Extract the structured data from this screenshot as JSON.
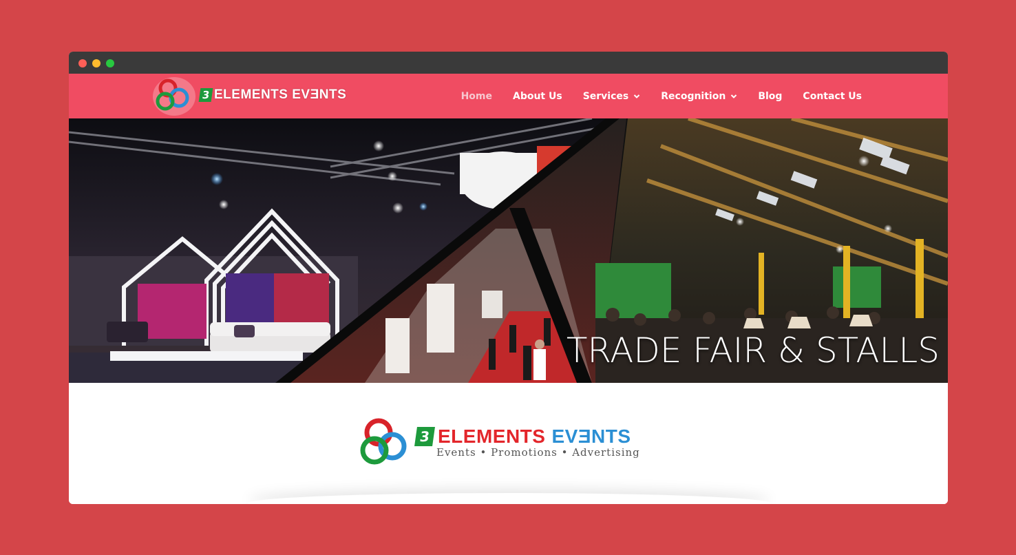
{
  "header": {
    "logo_number": "3",
    "logo_text": "ELEMENTS EVƎNTS"
  },
  "nav": {
    "items": [
      {
        "label": "Home",
        "active": true,
        "dropdown": false
      },
      {
        "label": "About Us",
        "active": false,
        "dropdown": false
      },
      {
        "label": "Services",
        "active": false,
        "dropdown": true
      },
      {
        "label": "Recognition",
        "active": false,
        "dropdown": true
      },
      {
        "label": "Blog",
        "active": false,
        "dropdown": false
      },
      {
        "label": "Contact Us",
        "active": false,
        "dropdown": false
      }
    ]
  },
  "hero": {
    "caption": "TRADE FAIR & STALLS"
  },
  "content": {
    "logo_number": "3",
    "logo_word1": "ELEMENTS",
    "logo_word2": "EVƎNTS",
    "tagline": "Events • Promotions • Advertising"
  },
  "colors": {
    "background": "#d44549",
    "header": "#f04c62",
    "titlebar": "#3a3a3a",
    "brand_red": "#e3262b",
    "brand_blue": "#2b8fd4",
    "brand_green": "#1d9a3c"
  }
}
